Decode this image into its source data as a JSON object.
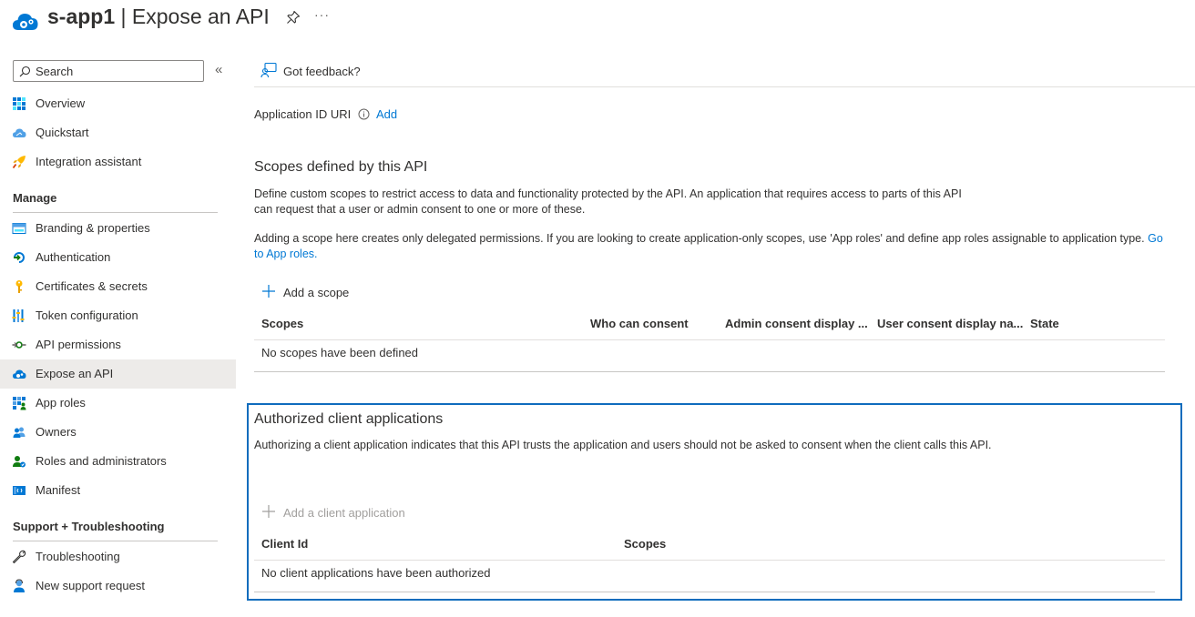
{
  "header": {
    "app_name": "s-app1",
    "separator": " | ",
    "page_title": "Expose an API",
    "more_label": "···"
  },
  "sidebar": {
    "search_placeholder": "Search",
    "collapse_label": "«",
    "items_top": [
      {
        "label": "Overview",
        "icon": "grid-icon"
      },
      {
        "label": "Quickstart",
        "icon": "cloud-icon"
      },
      {
        "label": "Integration assistant",
        "icon": "rocket-icon"
      }
    ],
    "manage_header": "Manage",
    "items_manage": [
      {
        "label": "Branding & properties",
        "icon": "branding-icon"
      },
      {
        "label": "Authentication",
        "icon": "authentication-icon"
      },
      {
        "label": "Certificates & secrets",
        "icon": "key-icon"
      },
      {
        "label": "Token configuration",
        "icon": "token-bars-icon"
      },
      {
        "label": "API permissions",
        "icon": "api-permissions-icon"
      },
      {
        "label": "Expose an API",
        "icon": "cloud-api-icon",
        "active": true
      },
      {
        "label": "App roles",
        "icon": "app-roles-icon"
      },
      {
        "label": "Owners",
        "icon": "owners-icon"
      },
      {
        "label": "Roles and administrators",
        "icon": "roles-admin-icon"
      },
      {
        "label": "Manifest",
        "icon": "manifest-icon"
      }
    ],
    "support_header": "Support + Troubleshooting",
    "items_support": [
      {
        "label": "Troubleshooting",
        "icon": "wrench-icon"
      },
      {
        "label": "New support request",
        "icon": "support-person-icon"
      }
    ]
  },
  "toolbar": {
    "feedback_label": "Got feedback?"
  },
  "app_id": {
    "label": "Application ID URI",
    "add_link": "Add"
  },
  "scopes": {
    "heading": "Scopes defined by this API",
    "desc1": "Define custom scopes to restrict access to data and functionality protected by the API. An application that requires access to parts of this API can request that a user or admin consent to one or more of these.",
    "desc2_text": "Adding a scope here creates only delegated permissions. If you are looking to create application-only scopes, use 'App roles' and define app roles assignable to application type.",
    "desc2_link": "Go to App roles.",
    "add_label": "Add a scope",
    "columns": [
      "Scopes",
      "Who can consent",
      "Admin consent display ...",
      "User consent display na...",
      "State"
    ],
    "empty": "No scopes have been defined"
  },
  "clients": {
    "heading": "Authorized client applications",
    "desc": "Authorizing a client application indicates that this API trusts the application and users should not be asked to consent when the client calls this API.",
    "add_label": "Add a client application",
    "columns": [
      "Client Id",
      "Scopes"
    ],
    "empty": "No client applications have been authorized"
  },
  "colors": {
    "accent": "#0078d4",
    "highlight_border": "#0f6cbd",
    "active_bg": "#edebe9",
    "disabled_text": "#a19f9d"
  }
}
